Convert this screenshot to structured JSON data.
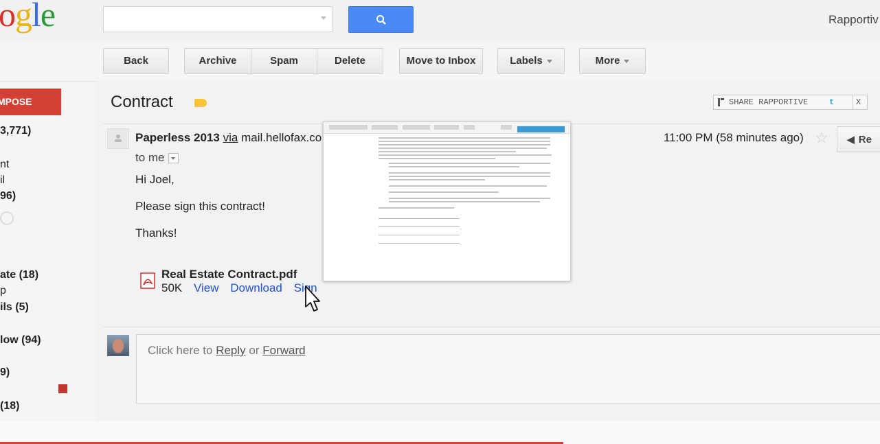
{
  "logo": "ogle",
  "header": {
    "rapportive": "Rapportiv"
  },
  "toolbar": {
    "back": "Back",
    "archive": "Archive",
    "spam": "Spam",
    "delete": "Delete",
    "move_to_inbox": "Move to Inbox",
    "labels": "Labels",
    "more": "More"
  },
  "sidebar": {
    "compose": "MPOSE",
    "items": [
      "3,771)",
      "nt",
      "il",
      "96)",
      "ate (18)",
      "p",
      "ils (5)",
      "low (94)",
      "9)",
      "(18)"
    ]
  },
  "email": {
    "subject": "Contract",
    "share_rapportive": "SHARE RAPPORTIVE",
    "share_close": "X",
    "sender_name": "Paperless 2013",
    "sender_via": "via",
    "sender_domain": "mail.hellofax.co",
    "time": "11:00 PM (58 minutes ago)",
    "reply_label": "Re",
    "to": "to me",
    "body": [
      "Hi Joel,",
      "Please sign this contract!",
      "Thanks!"
    ]
  },
  "attachment": {
    "name": "Real Estate Contract.pdf",
    "size": "50K",
    "view": "View",
    "download": "Download",
    "sign": "Sign"
  },
  "reply_box": {
    "prefix": "Click here to ",
    "reply": "Reply",
    "or": " or ",
    "forward": "Forward"
  },
  "colors": {
    "compose_red": "#d44134",
    "search_blue": "#4a8af4",
    "label_yellow": "#f3c537",
    "link_blue": "#1f51c9"
  }
}
